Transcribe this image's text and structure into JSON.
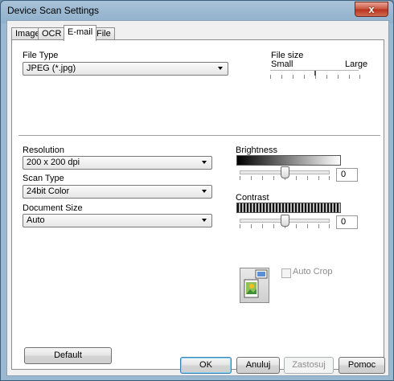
{
  "window": {
    "title": "Device Scan Settings",
    "close_glyph": "x"
  },
  "tabs": [
    {
      "label": "Image",
      "active": false
    },
    {
      "label": "OCR",
      "active": false
    },
    {
      "label": "E-mail",
      "active": true
    },
    {
      "label": "File",
      "active": false
    }
  ],
  "file_type": {
    "label": "File Type",
    "value": "JPEG (*.jpg)"
  },
  "file_size": {
    "label": "File size",
    "min_label": "Small",
    "max_label": "Large",
    "level": 0.5
  },
  "resolution": {
    "label": "Resolution",
    "value": "200 x 200 dpi"
  },
  "scan_type": {
    "label": "Scan Type",
    "value": "24bit Color"
  },
  "document_size": {
    "label": "Document Size",
    "value": "Auto"
  },
  "brightness": {
    "label": "Brightness",
    "value": "0",
    "level": 0.5
  },
  "contrast": {
    "label": "Contrast",
    "value": "0",
    "level": 0.5
  },
  "auto_crop": {
    "label": "Auto Crop",
    "checked": false,
    "enabled": false
  },
  "buttons": {
    "default": "Default",
    "ok": "OK",
    "cancel": "Anuluj",
    "apply": "Zastosuj",
    "help": "Pomoc"
  }
}
